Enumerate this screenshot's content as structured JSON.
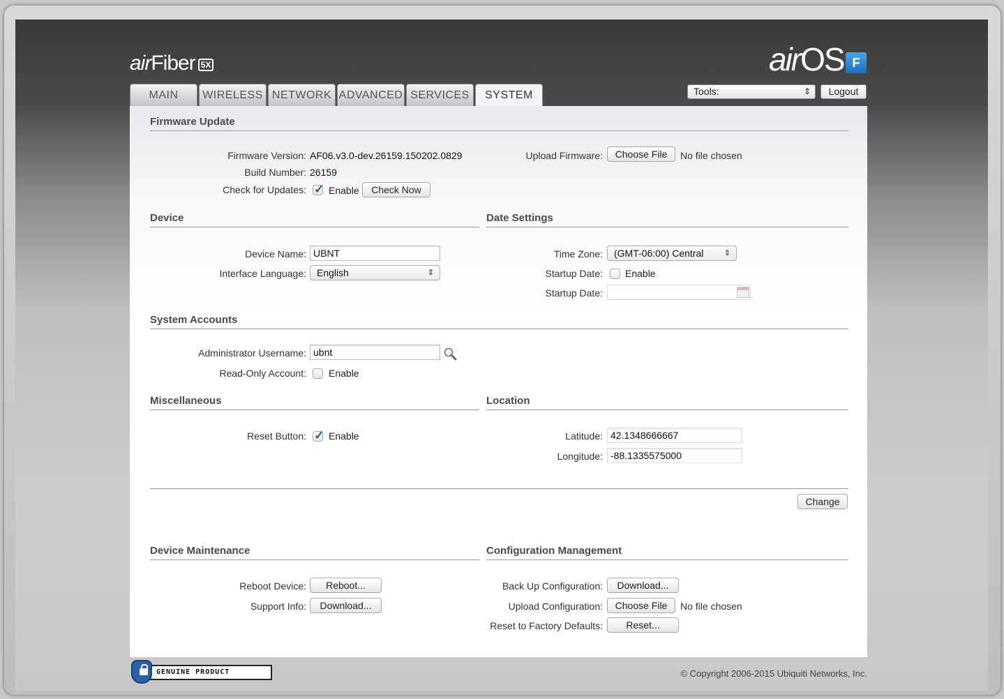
{
  "brand": {
    "left_air": "air",
    "left_fiber": "Fiber",
    "left_badge": "5X",
    "right_air": "air",
    "right_os": "OS",
    "right_badge": "F"
  },
  "tabs": [
    "MAIN",
    "WIRELESS",
    "NETWORK",
    "ADVANCED",
    "SERVICES",
    "SYSTEM"
  ],
  "active_tab": "SYSTEM",
  "header": {
    "tools_label": "Tools:",
    "logout_label": "Logout"
  },
  "firmware": {
    "title": "Firmware Update",
    "version_label": "Firmware Version:",
    "version_value": "AF06.v3.0-dev.26159.150202.0829",
    "build_label": "Build Number:",
    "build_value": "26159",
    "check_label": "Check for Updates:",
    "check_enable": "Enable",
    "check_checked": true,
    "check_now": "Check Now",
    "upload_label": "Upload Firmware:",
    "choose_file": "Choose File",
    "no_file": "No file chosen"
  },
  "device": {
    "title": "Device",
    "name_label": "Device Name:",
    "name_value": "UBNT",
    "lang_label": "Interface Language:",
    "lang_value": "English"
  },
  "date": {
    "title": "Date Settings",
    "tz_label": "Time Zone:",
    "tz_value": "(GMT-06:00) Central",
    "startup_label": "Startup Date:",
    "startup_enable": "Enable",
    "startup_checked": false,
    "startup_date_label": "Startup Date:",
    "startup_date_value": ""
  },
  "accounts": {
    "title": "System Accounts",
    "admin_label": "Administrator Username:",
    "admin_value": "ubnt",
    "readonly_label": "Read-Only Account:",
    "readonly_enable": "Enable",
    "readonly_checked": false
  },
  "misc": {
    "title": "Miscellaneous",
    "reset_label": "Reset Button:",
    "reset_enable": "Enable",
    "reset_checked": true
  },
  "location": {
    "title": "Location",
    "lat_label": "Latitude:",
    "lat_value": "42.1348666667",
    "lon_label": "Longitude:",
    "lon_value": "-88.1335575000"
  },
  "change_button": "Change",
  "maintenance": {
    "title": "Device Maintenance",
    "reboot_label": "Reboot Device:",
    "reboot_button": "Reboot...",
    "support_label": "Support Info:",
    "support_button": "Download..."
  },
  "config": {
    "title": "Configuration Management",
    "backup_label": "Back Up Configuration:",
    "backup_button": "Download...",
    "upload_label": "Upload Configuration:",
    "choose_file": "Choose File",
    "no_file": "No file chosen",
    "reset_label": "Reset to Factory Defaults:",
    "reset_button": "Reset..."
  },
  "footer": {
    "genuine_text": "GENUINE PRODUCT",
    "copyright": "© Copyright 2006-2015 Ubiquiti Networks, Inc."
  },
  "colors": {
    "check": "#2a5f9a",
    "panel_bg": "#ffffff",
    "header_dark": "#3a3a3a"
  }
}
